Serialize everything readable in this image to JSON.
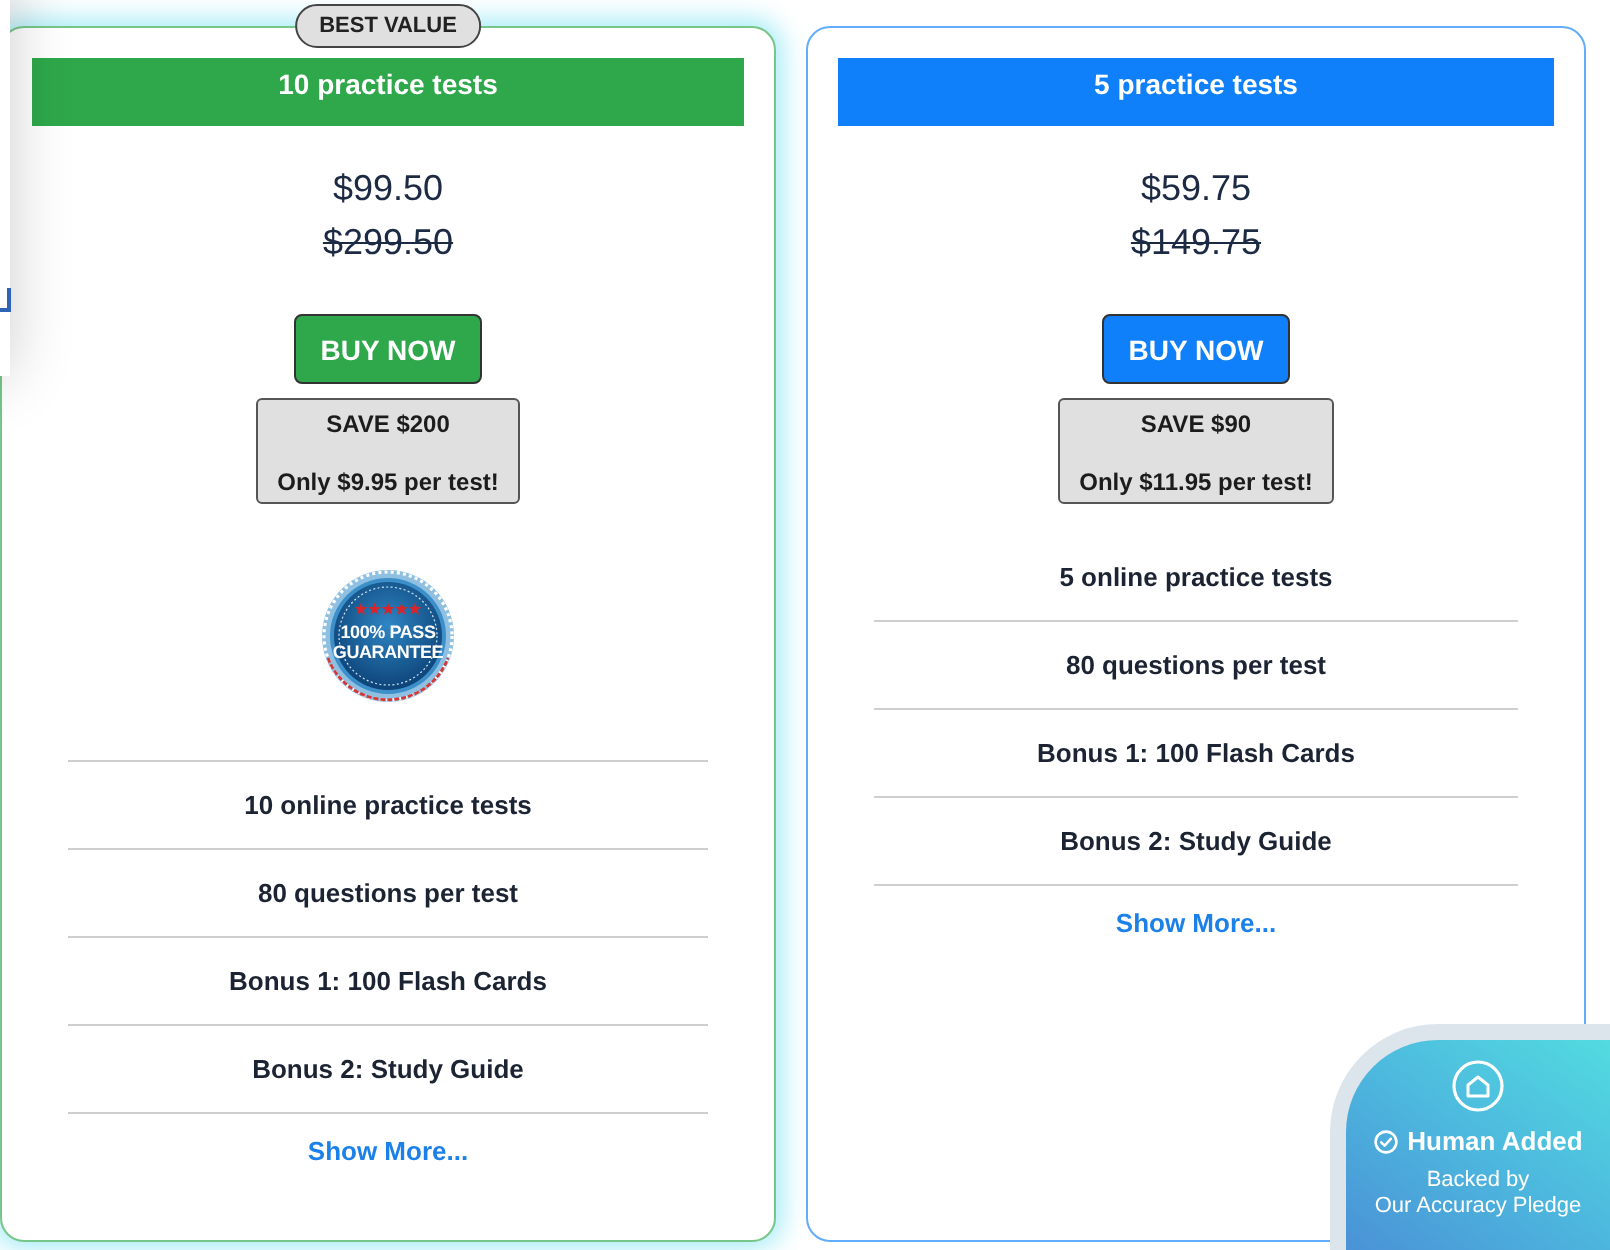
{
  "plans": [
    {
      "featured": true,
      "badge": "BEST VALUE",
      "color": "#2ea84a",
      "title": "10 practice tests",
      "price": "$99.50",
      "original_price": "$299.50",
      "button": "BUY NOW",
      "savings": "SAVE $200",
      "per_test": "Only $9.95 per test!",
      "guarantee": {
        "lines": [
          "100% PASS",
          "GUARANTEE"
        ]
      },
      "features": [
        "10 online practice tests",
        "80 questions per test",
        "Bonus 1: 100 Flash Cards",
        "Bonus 2: Study Guide"
      ],
      "show_more": "Show More..."
    },
    {
      "featured": false,
      "color": "#0f7ffa",
      "title": "5 practice tests",
      "price": "$59.75",
      "original_price": "$149.75",
      "button": "BUY NOW",
      "savings": "SAVE $90",
      "per_test": "Only $11.95 per test!",
      "features": [
        "5 online practice tests",
        "80 questions per test",
        "Bonus 1: 100 Flash Cards",
        "Bonus 2: Study Guide"
      ],
      "show_more": "Show More..."
    }
  ],
  "accuracy_card": {
    "title": "Human Added",
    "subtitle_lines": [
      "Backed by",
      "Our Accuracy Pledge"
    ]
  }
}
